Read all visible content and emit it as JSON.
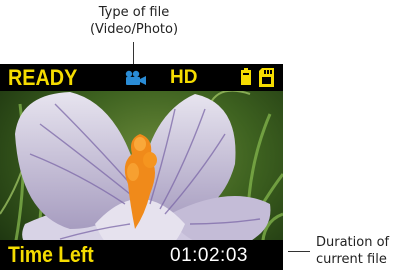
{
  "callouts": {
    "file_type_line1": "Type of file",
    "file_type_line2": "(Video/Photo)",
    "duration_line1": "Duration of",
    "duration_line2": "current file"
  },
  "screen": {
    "status": "READY",
    "mode_icon": "video-camera-icon",
    "quality": "HD",
    "battery_icon": "battery-icon",
    "storage_icon": "sd-card-icon",
    "time_left_label": "Time Left",
    "duration": "01:02:03"
  },
  "colors": {
    "overlay_text": "#f5dc00",
    "mode_icon": "#2a8cd6",
    "duration_text": "#ffffff",
    "bar_background": "#000000"
  }
}
